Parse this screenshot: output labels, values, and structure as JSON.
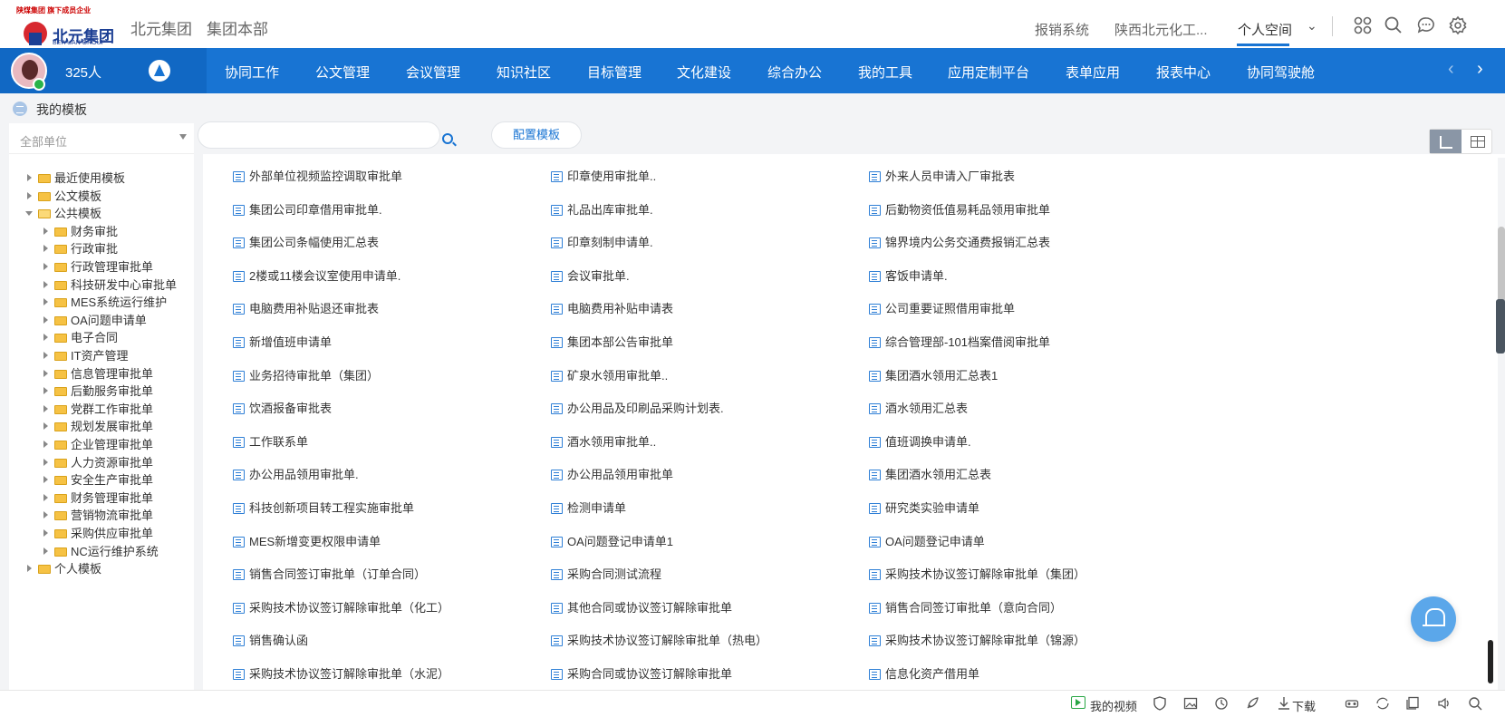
{
  "header": {
    "logo_top_text": "陕煤集团 旗下成员企业",
    "logo_name": "北元集团",
    "logo_en": "BEIYUAN GROUP",
    "org_name": "北元集团",
    "org_dept": "集团本部",
    "links": [
      "报销系统",
      "陕西北元化工...",
      "个人空间"
    ],
    "active_link": "个人空间"
  },
  "nav": {
    "online_count": "325人",
    "items": [
      "协同工作",
      "公文管理",
      "会议管理",
      "知识社区",
      "目标管理",
      "文化建设",
      "综合办公",
      "我的工具",
      "应用定制平台",
      "表单应用",
      "报表中心",
      "协同驾驶舱"
    ]
  },
  "subheader": {
    "title": "我的模板"
  },
  "left": {
    "unit_select": "全部单位",
    "tree": [
      {
        "label": "最近使用模板",
        "level": 0,
        "state": "closed"
      },
      {
        "label": "公文模板",
        "level": 0,
        "state": "closed"
      },
      {
        "label": "公共模板",
        "level": 0,
        "state": "open"
      },
      {
        "label": "财务审批",
        "level": 1,
        "state": "closed"
      },
      {
        "label": "行政审批",
        "level": 1,
        "state": "closed"
      },
      {
        "label": "行政管理审批单",
        "level": 1,
        "state": "closed"
      },
      {
        "label": "科技研发中心审批单",
        "level": 1,
        "state": "closed"
      },
      {
        "label": "MES系统运行维护",
        "level": 1,
        "state": "closed"
      },
      {
        "label": "OA问题申请单",
        "level": 1,
        "state": "closed"
      },
      {
        "label": "电子合同",
        "level": 1,
        "state": "closed"
      },
      {
        "label": "IT资产管理",
        "level": 1,
        "state": "closed"
      },
      {
        "label": "信息管理审批单",
        "level": 1,
        "state": "closed"
      },
      {
        "label": "后勤服务审批单",
        "level": 1,
        "state": "closed"
      },
      {
        "label": "党群工作审批单",
        "level": 1,
        "state": "closed"
      },
      {
        "label": "规划发展审批单",
        "level": 1,
        "state": "closed"
      },
      {
        "label": "企业管理审批单",
        "level": 1,
        "state": "closed"
      },
      {
        "label": "人力资源审批单",
        "level": 1,
        "state": "closed"
      },
      {
        "label": "安全生产审批单",
        "level": 1,
        "state": "closed"
      },
      {
        "label": "财务管理审批单",
        "level": 1,
        "state": "closed"
      },
      {
        "label": "营销物流审批单",
        "level": 1,
        "state": "closed"
      },
      {
        "label": "采购供应审批单",
        "level": 1,
        "state": "closed"
      },
      {
        "label": "NC运行维护系统",
        "level": 1,
        "state": "closed"
      },
      {
        "label": "个人模板",
        "level": 0,
        "state": "closed"
      }
    ]
  },
  "toolbar": {
    "search_placeholder": "",
    "config_button": "配置模板"
  },
  "templates": [
    [
      "外部单位视频监控调取审批单",
      "印章使用审批单..",
      "外来人员申请入厂审批表"
    ],
    [
      "集团公司印章借用审批单.",
      "礼品出库审批单.",
      "后勤物资低值易耗品领用审批单"
    ],
    [
      "集团公司条幅使用汇总表",
      "印章刻制申请单.",
      "锦界境内公务交通费报销汇总表"
    ],
    [
      "2楼或11楼会议室使用申请单.",
      "会议审批单.",
      "客饭申请单."
    ],
    [
      "电脑费用补贴退还审批表",
      "电脑费用补贴申请表",
      "公司重要证照借用审批单"
    ],
    [
      "新增值班申请单",
      "集团本部公告审批单",
      "综合管理部-101档案借阅审批单"
    ],
    [
      "业务招待审批单（集团）",
      "矿泉水领用审批单..",
      "集团酒水领用汇总表1"
    ],
    [
      "饮酒报备审批表",
      "办公用品及印刷品采购计划表.",
      "酒水领用汇总表"
    ],
    [
      "工作联系单",
      "酒水领用审批单..",
      "值班调换申请单."
    ],
    [
      "办公用品领用审批单.",
      "办公用品领用审批单",
      "集团酒水领用汇总表"
    ],
    [
      "科技创新项目转工程实施审批单",
      "检测申请单",
      "研究类实验申请单"
    ],
    [
      "MES新增变更权限申请单",
      "OA问题登记申请单1",
      "OA问题登记申请单"
    ],
    [
      "销售合同签订审批单（订单合同）",
      "采购合同测试流程",
      "采购技术协议签订解除审批单（集团）"
    ],
    [
      "采购技术协议签订解除审批单（化工）",
      "其他合同或协议签订解除审批单",
      "销售合同签订审批单（意向合同）"
    ],
    [
      "销售确认函",
      "采购技术协议签订解除审批单（热电）",
      "采购技术协议签订解除审批单（锦源）"
    ],
    [
      "采购技术协议签订解除审批单（水泥）",
      "采购合同或协议签订解除审批单",
      "信息化资产借用单"
    ]
  ],
  "statusbar": {
    "video_label": "我的视频",
    "download_label": "下载"
  },
  "colors": {
    "primary": "#1874d3",
    "nav_dark": "#1168c4",
    "accent_red": "#d7282f"
  }
}
